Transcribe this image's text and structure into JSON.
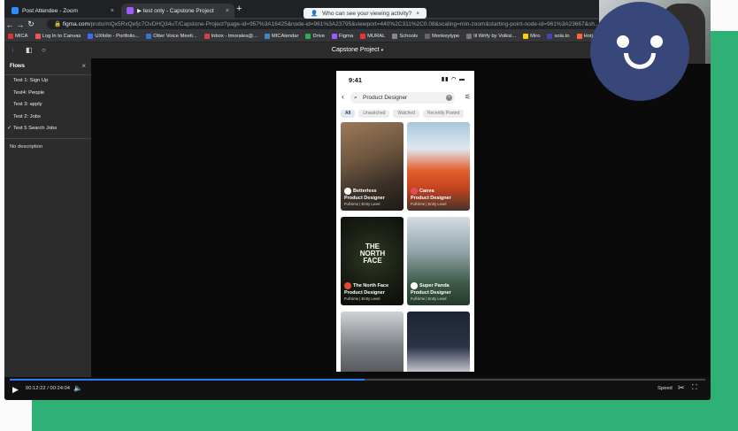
{
  "colors": {
    "accent": "#2fb074",
    "avatar": "#38477a",
    "progress": "#2a7ef2"
  },
  "browser": {
    "tabs": [
      {
        "label": "Post Attendee - Zoom",
        "icon": "zoom-icon"
      },
      {
        "label": "▶ test only - Capstone Project",
        "icon": "figma-icon"
      }
    ],
    "new_tab": "+",
    "toast": "Who can see your viewing activity?",
    "url_host": "figma.com",
    "url_rest": "/proto/mQx5RxQefjc7OvDHQ34uT/Capstone-Project?page-id=957%3A16425&node-id=961%3A23795&viewport=440%2C311%2C0.08&scaling=min-zoom&starting-point-node-id=961%3A23667&sh...",
    "bookmarks": [
      "MICA",
      "Log In to Canvas",
      "UXfolio - Portfolio...",
      "Otter Voice Meeti...",
      "Inbox - tmorales@...",
      "MICAlendar",
      "Drive",
      "Figma",
      "MURAL",
      "Schools",
      "Monkeytype",
      "lil Wrify by Volksi...",
      "Miro",
      "sola.to",
      "Hotjar"
    ]
  },
  "figma": {
    "title": "Capstone Project",
    "flows_header": "Flows",
    "flows": [
      "Test 1: Sign Up",
      "Test4: People",
      "Test 3: apply",
      "Test 2: Jobs",
      "Test 5 Search Jobs"
    ],
    "active_flow": 4,
    "description": "No description"
  },
  "phone": {
    "time": "9:41",
    "search_value": "Product Designer",
    "chips": [
      "All",
      "Unwatched",
      "Watched",
      "Recently Posted"
    ],
    "cards": [
      {
        "company": "Betterless",
        "role": "Product Designer",
        "meta": "Full-time | Entry Level"
      },
      {
        "company": "Canva",
        "role": "Product Designer",
        "meta": "Full-time | Entry Level"
      },
      {
        "company": "The North Face",
        "role": "Product Designer",
        "meta": "Full-time | Entry Level"
      },
      {
        "company": "Super Panda",
        "role": "Product Designer",
        "meta": "Full-time | Entry Level"
      },
      {
        "company": "",
        "role": "",
        "meta": ""
      },
      {
        "company": "",
        "role": "",
        "meta": ""
      }
    ],
    "tnf_logo": "THE NORTH FACE"
  },
  "video": {
    "current": "00:12:22",
    "total": "00:24:04",
    "progress": 0.51,
    "speed_label": "Speed"
  }
}
